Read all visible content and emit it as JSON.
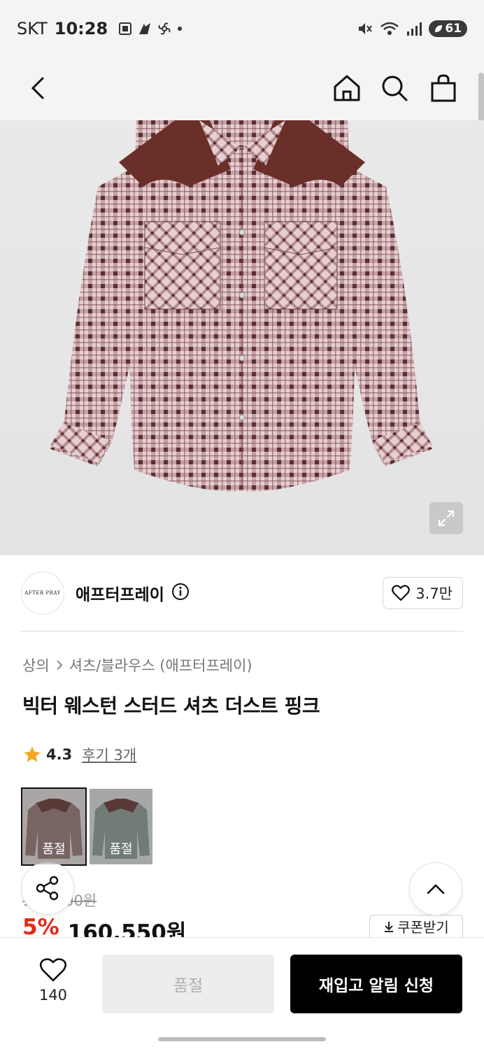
{
  "status_bar": {
    "carrier": "SKT",
    "time": "10:28",
    "battery": "61"
  },
  "header": {
    "icons": [
      "back-icon",
      "home-icon",
      "search-icon",
      "bag-icon"
    ]
  },
  "brand": {
    "logo_text": "AFTER PRAY",
    "name": "애프터프레이",
    "likes": "3.7만"
  },
  "breadcrumb": {
    "category": "상의",
    "subcategory": "셔츠/블라우스 (애프터프레이)"
  },
  "product": {
    "title": "빅터 웨스턴 스터드 셔츠 더스트 핑크",
    "rating": "4.3",
    "reviews": "후기 3개",
    "original_price": "169,000원",
    "discount": "5%",
    "sale_price": "160,550원",
    "coupon_label": "쿠폰받기"
  },
  "swatches": [
    {
      "label": "품절",
      "color": "#8a6a6a"
    },
    {
      "label": "품절",
      "color": "#7f8f86"
    }
  ],
  "bottom_bar": {
    "wish_count": "140",
    "soldout_label": "품절",
    "restock_label": "재입고 알림 신청"
  },
  "colors": {
    "accent_red": "#e2291a",
    "primary_black": "#000000",
    "star": "#f5a623"
  }
}
